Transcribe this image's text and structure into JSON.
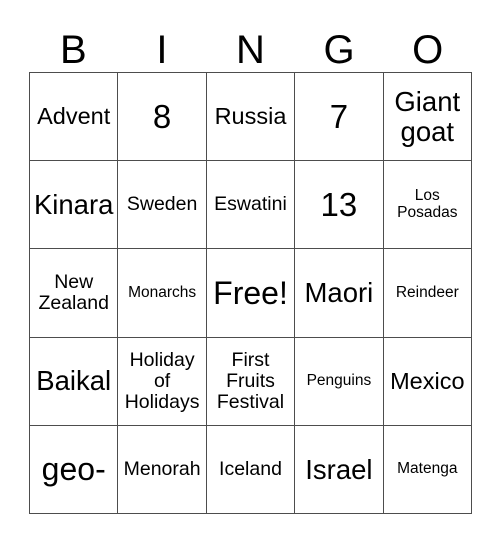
{
  "card": {
    "headers": [
      "B",
      "I",
      "N",
      "G",
      "O"
    ],
    "rows": [
      [
        {
          "text": "Advent",
          "size": "fs-md"
        },
        {
          "text": "8",
          "size": "fs-num"
        },
        {
          "text": "Russia",
          "size": "fs-md"
        },
        {
          "text": "7",
          "size": "fs-num"
        },
        {
          "text": "Giant\ngoat",
          "size": "fs-lg"
        }
      ],
      [
        {
          "text": "Kinara",
          "size": "fs-lg"
        },
        {
          "text": "Sweden",
          "size": "fs-sm"
        },
        {
          "text": "Eswatini",
          "size": "fs-sm"
        },
        {
          "text": "13",
          "size": "fs-num"
        },
        {
          "text": "Los\nPosadas",
          "size": "fs-xs"
        }
      ],
      [
        {
          "text": "New\nZealand",
          "size": "fs-sm"
        },
        {
          "text": "Monarchs",
          "size": "fs-xs"
        },
        {
          "text": "Free!",
          "size": "fs-xl"
        },
        {
          "text": "Maori",
          "size": "fs-lg"
        },
        {
          "text": "Reindeer",
          "size": "fs-xs"
        }
      ],
      [
        {
          "text": "Baikal",
          "size": "fs-lg"
        },
        {
          "text": "Holiday\nof\nHolidays",
          "size": "fs-sm"
        },
        {
          "text": "First\nFruits\nFestival",
          "size": "fs-sm"
        },
        {
          "text": "Penguins",
          "size": "fs-xs"
        },
        {
          "text": "Mexico",
          "size": "fs-md"
        }
      ],
      [
        {
          "text": "geo-",
          "size": "fs-xl"
        },
        {
          "text": "Menorah",
          "size": "fs-sm"
        },
        {
          "text": "Iceland",
          "size": "fs-sm"
        },
        {
          "text": "Israel",
          "size": "fs-lg"
        },
        {
          "text": "Matenga",
          "size": "fs-xs"
        }
      ]
    ],
    "free_space": {
      "row": 2,
      "col": 2,
      "label": "Free!"
    },
    "colors": {
      "background": "#ffffff",
      "text": "#000000",
      "grid_line": "#4d4d4d"
    }
  }
}
